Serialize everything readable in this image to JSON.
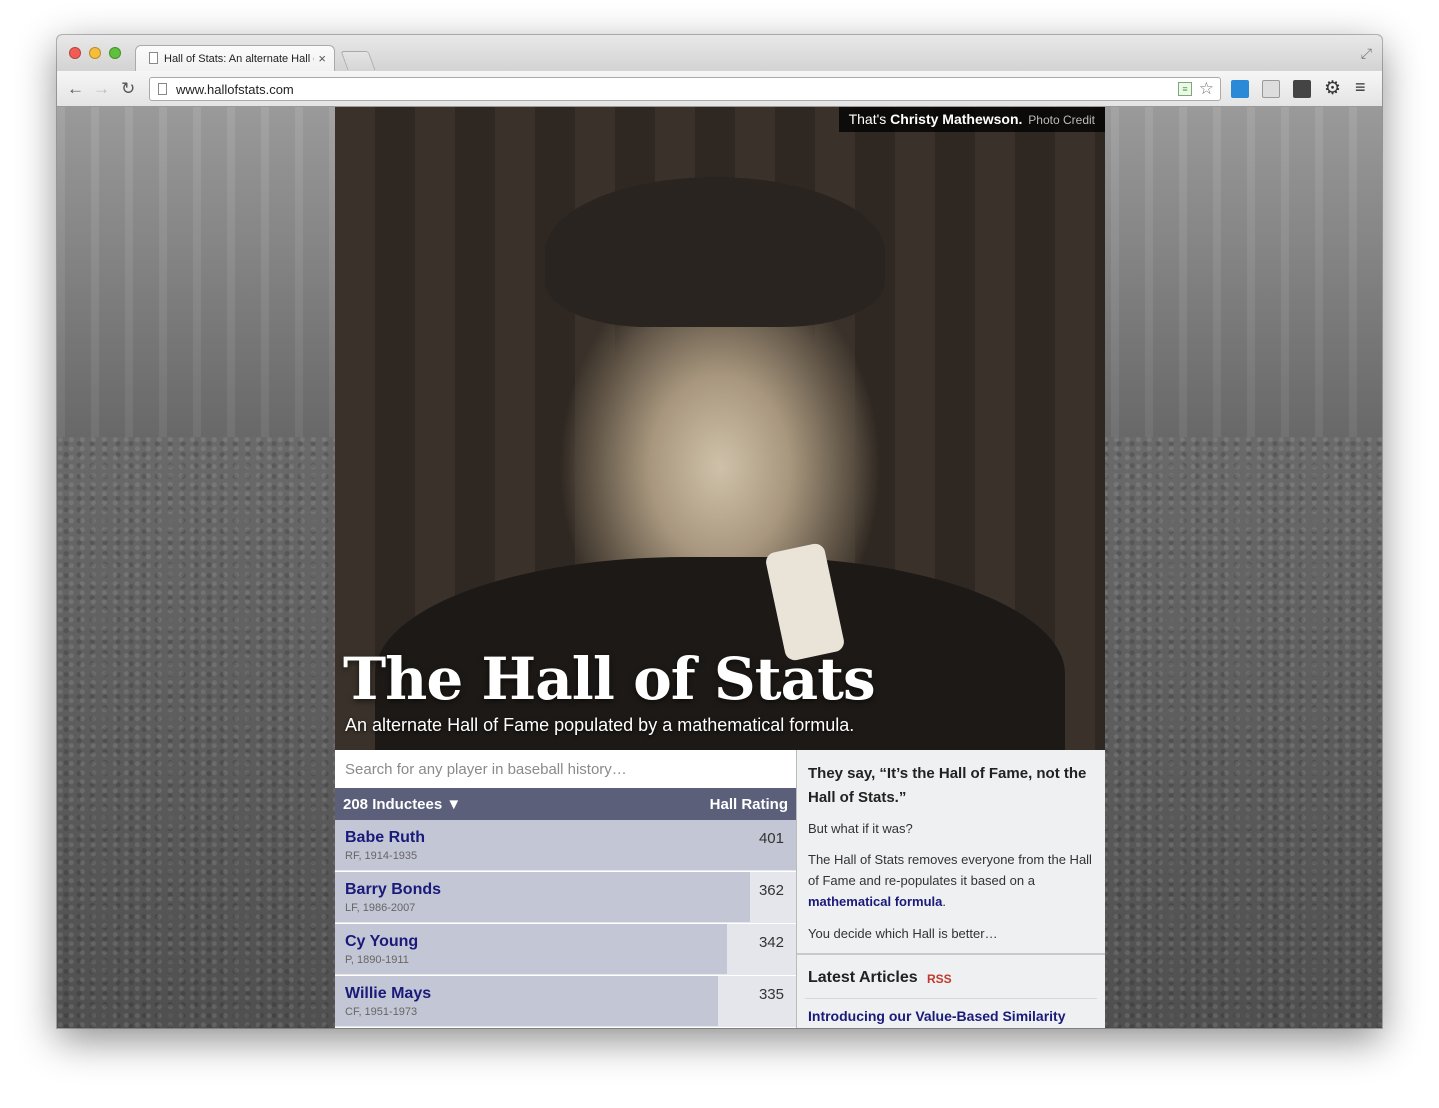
{
  "browser": {
    "tab_title": "Hall of Stats: An alternate Hall of Fame",
    "tab_close": "×",
    "url": "www.hallofstats.com"
  },
  "hero": {
    "credit_prefix": "That's",
    "credit_name": "Christy Mathewson.",
    "credit_link": "Photo Credit",
    "title": "The Hall of Stats",
    "tagline": "An alternate Hall of Fame populated by a mathematical formula."
  },
  "search": {
    "placeholder": "Search for any player in baseball history…"
  },
  "list": {
    "count_label": "208 Inductees ▼",
    "rating_label": "Hall Rating",
    "players": [
      {
        "name": "Babe Ruth",
        "meta": "RF, 1914-1935",
        "rating": "401",
        "fill": 1.0
      },
      {
        "name": "Barry Bonds",
        "meta": "LF, 1986-2007",
        "rating": "362",
        "fill": 0.9
      },
      {
        "name": "Cy Young",
        "meta": "P, 1890-1911",
        "rating": "342",
        "fill": 0.85
      },
      {
        "name": "Willie Mays",
        "meta": "CF, 1951-1973",
        "rating": "335",
        "fill": 0.83
      }
    ]
  },
  "intro": {
    "quote": "They say, “It’s the Hall of Fame, not the Hall of Stats.”",
    "p1": "But what if it was?",
    "p2_text": "The Hall of Stats removes everyone from the Hall of Fame and re-populates it based on a",
    "p2_link": "mathematical formula",
    "p2_end": ".",
    "p3": "You decide which Hall is better…"
  },
  "articles": {
    "title": "Latest Articles",
    "rss": "RSS",
    "first": "Introducing our Value-Based Similarity"
  }
}
